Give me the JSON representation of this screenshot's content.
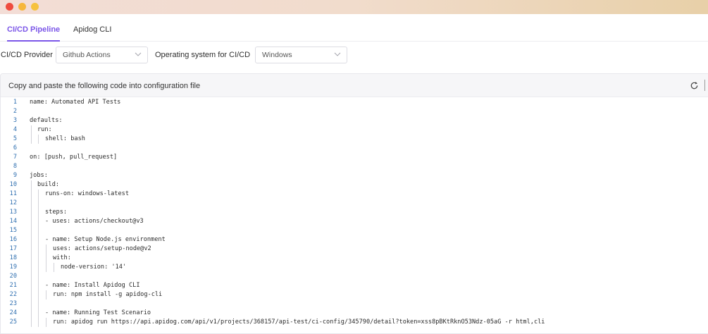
{
  "window": {
    "controls": [
      "close",
      "minimize",
      "maximize"
    ]
  },
  "tabs": [
    {
      "label": "CI/CD Pipeline",
      "active": true
    },
    {
      "label": "Apidog CLI",
      "active": false
    }
  ],
  "filters": {
    "provider_label": "CI/CD Provider",
    "provider_value": "Github Actions",
    "os_label": "Operating system for CI/CD",
    "os_value": "Windows"
  },
  "panel": {
    "title": "Copy and paste the following code into configuration file",
    "refresh_icon": "refresh-icon"
  },
  "code_lines": [
    {
      "n": "1",
      "text": "name: Automated API Tests",
      "indent": 0
    },
    {
      "n": "2",
      "text": "",
      "indent": 0
    },
    {
      "n": "3",
      "text": "defaults:",
      "indent": 0
    },
    {
      "n": "4",
      "text": "run:",
      "indent": 1
    },
    {
      "n": "5",
      "text": "shell: bash",
      "indent": 2
    },
    {
      "n": "6",
      "text": "",
      "indent": 0
    },
    {
      "n": "7",
      "text": "on: [push, pull_request]",
      "indent": 0
    },
    {
      "n": "8",
      "text": "",
      "indent": 0
    },
    {
      "n": "9",
      "text": "jobs:",
      "indent": 0
    },
    {
      "n": "10",
      "text": "build:",
      "indent": 1
    },
    {
      "n": "11",
      "text": "runs-on: windows-latest",
      "indent": 2
    },
    {
      "n": "12",
      "text": "",
      "indent": 2
    },
    {
      "n": "13",
      "text": "steps:",
      "indent": 2
    },
    {
      "n": "14",
      "text": "- uses: actions/checkout@v3",
      "indent": 2
    },
    {
      "n": "15",
      "text": "",
      "indent": 2
    },
    {
      "n": "16",
      "text": "- name: Setup Node.js environment",
      "indent": 2
    },
    {
      "n": "17",
      "text": "uses: actions/setup-node@v2",
      "indent": 3
    },
    {
      "n": "18",
      "text": "with:",
      "indent": 3
    },
    {
      "n": "19",
      "text": "node-version: '14'",
      "indent": 4
    },
    {
      "n": "20",
      "text": "",
      "indent": 2
    },
    {
      "n": "21",
      "text": "- name: Install Apidog CLI",
      "indent": 2
    },
    {
      "n": "22",
      "text": "run: npm install -g apidog-cli",
      "indent": 3
    },
    {
      "n": "23",
      "text": "",
      "indent": 2
    },
    {
      "n": "24",
      "text": "- name: Running Test Scenario",
      "indent": 2
    },
    {
      "n": "25",
      "text": "run: apidog run https://api.apidog.com/api/v1/projects/368157/api-test/ci-config/345790/detail?token=xss8pBKtRknO53Ndz-05aG -r html,cli",
      "indent": 3
    }
  ]
}
